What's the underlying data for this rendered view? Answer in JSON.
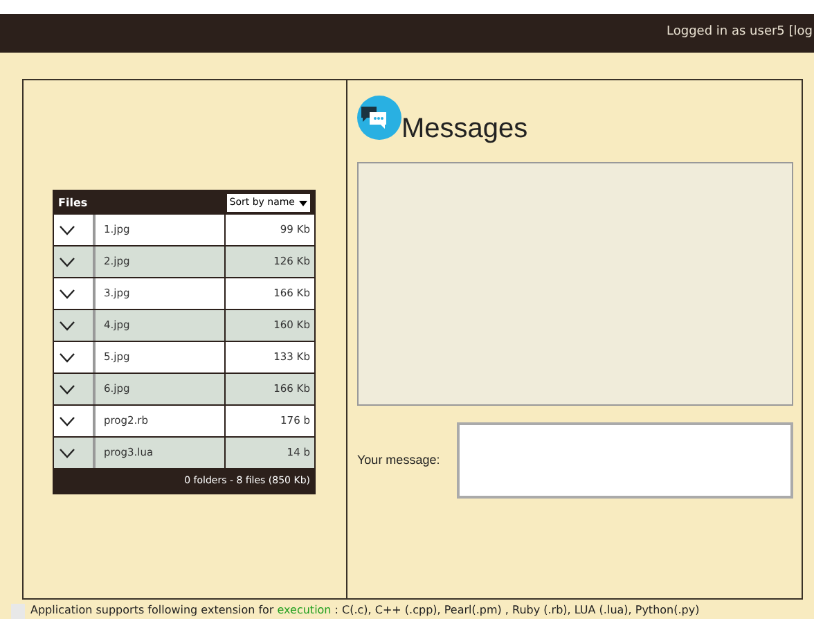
{
  "top_bar": {
    "login_text": "Logged in as user5 [log"
  },
  "files": {
    "title": "Files",
    "sort": "Sort by name",
    "rows": [
      {
        "name": "1.jpg",
        "size": "99 Kb"
      },
      {
        "name": "2.jpg",
        "size": "126 Kb"
      },
      {
        "name": "3.jpg",
        "size": "166 Kb"
      },
      {
        "name": "4.jpg",
        "size": "160 Kb"
      },
      {
        "name": "5.jpg",
        "size": "133 Kb"
      },
      {
        "name": "6.jpg",
        "size": "166 Kb"
      },
      {
        "name": "prog2.rb",
        "size": "176 b"
      },
      {
        "name": "prog3.lua",
        "size": "14 b"
      }
    ],
    "summary": "0 folders - 8 files (850 Kb)"
  },
  "messages": {
    "title": "Messages",
    "your_message_label": "Your message:"
  },
  "footer": {
    "before": "Application supports following extension for",
    "link": "execution",
    "after": ": C(.c), C++ (.cpp), Pearl(.pm) , Ruby (.rb), LUA (.lua), Python(.py)"
  }
}
